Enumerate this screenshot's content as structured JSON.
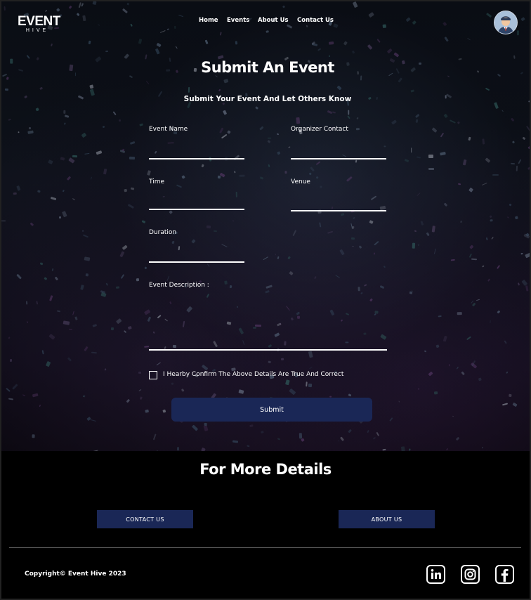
{
  "brand": {
    "name": "EVENT",
    "sub": "HIVE"
  },
  "nav": {
    "items": [
      "Home",
      "Events",
      "About Us",
      "Contact Us"
    ]
  },
  "form": {
    "title": "Submit An Event",
    "subtitle": "Submit Your Event And Let Others Know",
    "fields": {
      "event_name": "Event Name",
      "organizer_contact": "Organizer Contact",
      "time": "Time",
      "venue": "Venue",
      "duration": "Duration",
      "description": "Event Description :"
    },
    "confirm": "I Hearby Confirm The Above Details Are True And Correct",
    "submit": "Submit"
  },
  "footer": {
    "heading": "For More Details",
    "contact_button": "CONTACT  US",
    "about_button": "ABOUT US",
    "copyright": "Copyright© Event Hive 2023",
    "social": [
      "linkedin-icon",
      "instagram-icon",
      "facebook-icon"
    ]
  },
  "colors": {
    "accent": "#1a2756",
    "background": "#000000",
    "text": "#ffffff"
  }
}
